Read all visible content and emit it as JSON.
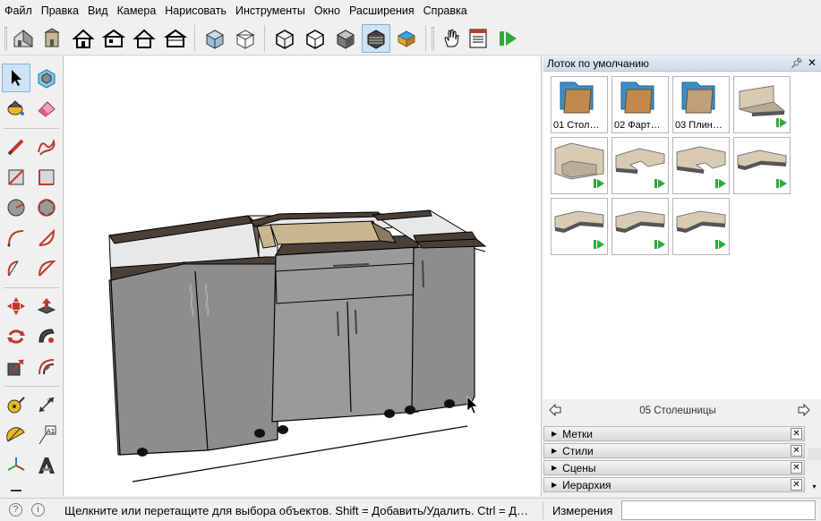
{
  "menu": [
    "Файл",
    "Правка",
    "Вид",
    "Камера",
    "Нарисовать",
    "Инструменты",
    "Окно",
    "Расширения",
    "Справка"
  ],
  "icons": {
    "toolbar": [
      "house-iso-icon",
      "house-front-icon",
      "house-icon",
      "house-side-icon",
      "house-outline-icon",
      "house-back-icon",
      "xray-style-icon",
      "wireframe-style-icon",
      "hidden-line-style-icon",
      "shaded-style-icon",
      "shaded-texture-style-icon",
      "monochrome-style-icon",
      "sandbox-icon",
      "hand-pointer-icon",
      "model-info-icon",
      "extension-play-icon"
    ],
    "left_tools": [
      "select-arrow-icon",
      "component-icon",
      "paint-bucket-icon",
      "eraser-icon",
      "pencil-icon",
      "freehand-icon",
      "rectangle-icon",
      "rotated-rectangle-icon",
      "circle-icon",
      "polygon-icon",
      "arc-icon",
      "pie-arc-icon",
      "two-point-arc-icon",
      "three-point-arc-icon",
      "move-icon",
      "push-pull-icon",
      "rotate-icon",
      "follow-me-icon",
      "scale-icon",
      "offset-icon",
      "tape-measure-icon",
      "dimension-icon",
      "protractor-icon",
      "text-icon",
      "axes-icon",
      "3d-text-icon"
    ]
  },
  "tray": {
    "title": "Лоток по умолчанию",
    "components": [
      {
        "caption": "01 Стол…",
        "kind": "folder"
      },
      {
        "caption": "02 Фарт…",
        "kind": "folder"
      },
      {
        "caption": "03 Плин…",
        "kind": "folder"
      },
      {
        "caption": "",
        "kind": "countertop-flat"
      },
      {
        "caption": "",
        "kind": "countertop-box"
      },
      {
        "caption": "",
        "kind": "countertop-u"
      },
      {
        "caption": "",
        "kind": "countertop-u2"
      },
      {
        "caption": "",
        "kind": "countertop-l"
      },
      {
        "caption": "",
        "kind": "countertop-l2"
      },
      {
        "caption": "",
        "kind": "countertop-l3"
      },
      {
        "caption": "",
        "kind": "countertop-l4"
      }
    ],
    "collection_name": "05 Столешницы",
    "panels": [
      "Метки",
      "Стили",
      "Сцены",
      "Иерархия"
    ]
  },
  "status": {
    "hint": "Щелкните или перетащите для выбора объектов. Shift = Добавить/Удалить. Ctrl = Д…",
    "measurements_label": "Измерения",
    "measurements_value": ""
  },
  "colors": {
    "selected_tool_bg": "#cfe3f5",
    "cabinet_body": "#8c8c8c",
    "countertop": "#4a4038",
    "component_badge": "#2eaa3a"
  }
}
